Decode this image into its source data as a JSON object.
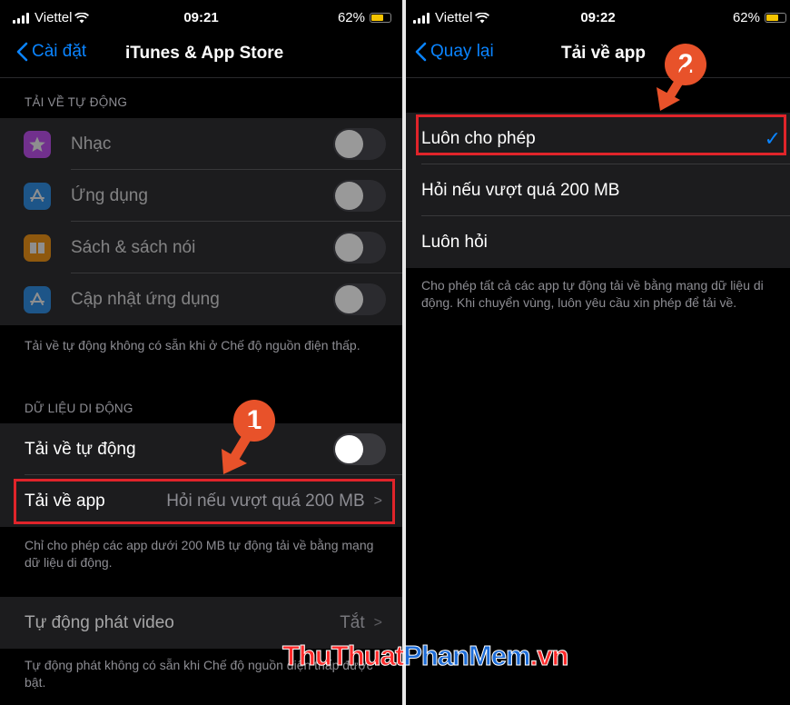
{
  "left": {
    "status": {
      "carrier": "Viettel",
      "time": "09:21",
      "battery": "62%",
      "battery_level": 0.62
    },
    "nav": {
      "back_label": "Cài đặt",
      "title": "iTunes & App Store"
    },
    "auto_downloads": {
      "header": "TẢI VỀ TỰ ĐỘNG",
      "items": [
        {
          "label": "Nhạc",
          "icon": "star-icon",
          "color": "#c644fc",
          "on": false
        },
        {
          "label": "Ứng dụng",
          "icon": "app-store-icon",
          "color": "#1f8ef1",
          "on": false
        },
        {
          "label": "Sách & sách nói",
          "icon": "book-icon",
          "color": "#ff9500",
          "on": false
        },
        {
          "label": "Cập nhật ứng dụng",
          "icon": "app-store-icon",
          "color": "#1f8ef1",
          "on": false
        }
      ],
      "footer": "Tải về tự động không có sẵn khi ở Chế độ nguồn điện thấp."
    },
    "cellular": {
      "header": "DỮ LIỆU DI ĐỘNG",
      "auto_label": "Tải về tự động",
      "auto_on": false,
      "app_download_label": "Tải về app",
      "app_download_value": "Hỏi nếu vượt quá 200 MB",
      "footer": "Chỉ cho phép các app dưới 200 MB tự động tải về bằng mạng dữ liệu di động."
    },
    "video": {
      "label": "Tự động phát video",
      "value": "Tắt",
      "footer": "Tự động phát không có sẵn khi Chế độ nguồn điện thấp được bật."
    },
    "step_badge": "1"
  },
  "right": {
    "status": {
      "carrier": "Viettel",
      "time": "09:22",
      "battery": "62%",
      "battery_level": 0.62
    },
    "nav": {
      "back_label": "Quay lại",
      "title": "Tải về app"
    },
    "options": [
      {
        "label": "Luôn cho phép",
        "selected": true
      },
      {
        "label": "Hỏi nếu vượt quá 200 MB",
        "selected": false
      },
      {
        "label": "Luôn hỏi",
        "selected": false
      }
    ],
    "footer": "Cho phép tất cả các app tự động tải về bằng mạng dữ liệu di động. Khi chuyển vùng, luôn yêu cầu xin phép để tải về.",
    "step_badge": "2"
  },
  "watermark": {
    "part1": "ThuThuat",
    "part2": "PhanMem",
    "part3": ".vn"
  },
  "colors": {
    "accent": "#0a84ff",
    "highlight": "#e0242a",
    "badge": "#e8522a"
  }
}
